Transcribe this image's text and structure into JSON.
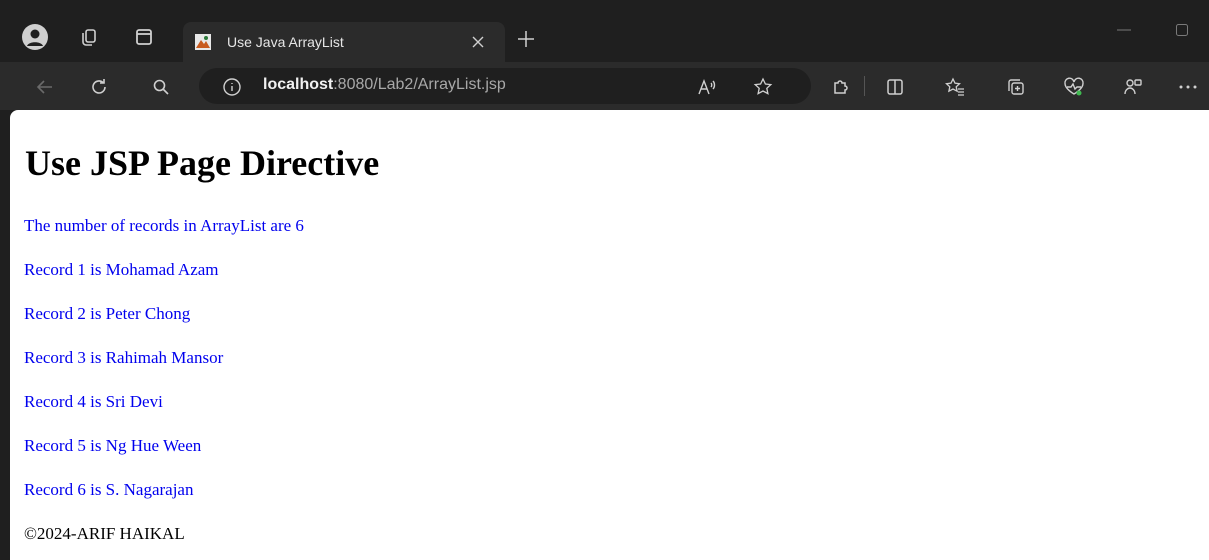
{
  "browser": {
    "tab": {
      "title": "Use Java ArrayList"
    },
    "address": {
      "host": "localhost",
      "path": ":8080/Lab2/ArrayList.jsp"
    },
    "icons": [
      "profile-icon",
      "tab-actions-icon",
      "vertical-tabs-icon",
      "favicon-icon",
      "close-icon",
      "plus-icon",
      "minimize-icon",
      "maximize-icon",
      "back-icon",
      "refresh-icon",
      "search-icon",
      "info-icon",
      "read-aloud-icon",
      "favorite-icon",
      "extensions-icon",
      "split-screen-icon",
      "favorites-icon",
      "collections-icon",
      "health-icon",
      "copilot-icon",
      "more-icon"
    ]
  },
  "page": {
    "heading": "Use JSP Page Directive",
    "count_text": "The number of records in ArrayList are 6",
    "records": [
      "Record 1 is Mohamad Azam",
      "Record 2 is Peter Chong",
      "Record 3 is Rahimah Mansor",
      "Record 4 is Sri Devi",
      "Record 5 is Ng Hue Ween",
      "Record 6 is S. Nagarajan"
    ],
    "footer": "©2024-ARIF HAIKAL"
  },
  "colors": {
    "link": "#0000ee",
    "chrome_dark": "#1f1f1f",
    "chrome_toolbar": "#2b2b2b"
  }
}
